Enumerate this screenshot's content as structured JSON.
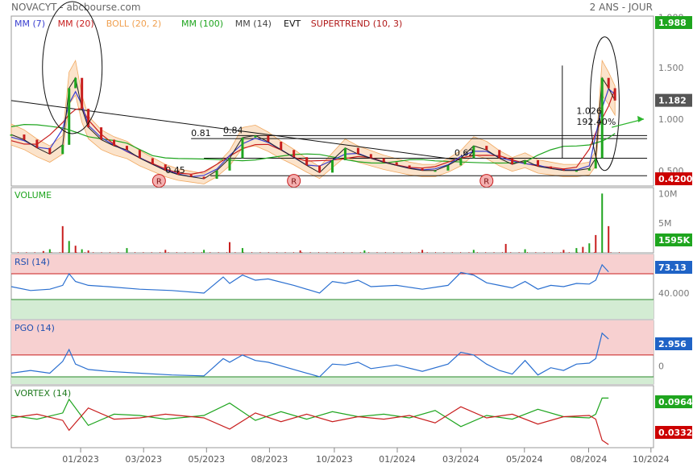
{
  "header": {
    "source": "NOVACYT - abcbourse.com",
    "period": "2 ANS - JOUR"
  },
  "colors": {
    "mm7": "#3a3fd0",
    "mm20": "#c81e1e",
    "boll": "#f0a050",
    "mm100": "#1fa51f",
    "mm14": "#444444",
    "evt": "#111111",
    "supertrend": "#b01818",
    "rsi_line": "#2a6fd0",
    "band_high": "#f7d0d0",
    "band_low": "#d3ecd3",
    "badge_green": "#1ea51e",
    "badge_red": "#cc0000",
    "badge_grey": "#555555",
    "badge_blue": "#1f63c6"
  },
  "chart_data": [
    {
      "panel": "price",
      "type": "line",
      "legend": [
        {
          "label": "MM (7)",
          "color": "#3a3fd0"
        },
        {
          "label": "MM (20)",
          "color": "#c81e1e"
        },
        {
          "label": "BOLL (20, 2)",
          "color": "#f0a050"
        },
        {
          "label": "MM (100)",
          "color": "#1fa51f"
        },
        {
          "label": "MM (14)",
          "color": "#444444"
        },
        {
          "label": "EVT",
          "color": "#111111"
        },
        {
          "label": "SUPERTREND (10, 3)",
          "color": "#b01818"
        }
      ],
      "x_ticks": [
        "01/2023",
        "03/2023",
        "05/2023",
        "08/2023",
        "10/2023",
        "01/2024",
        "03/2024",
        "05/2024",
        "08/2024",
        "10/2024"
      ],
      "y_ticks": [
        "1.988",
        "1.500",
        "1.000",
        "0.500"
      ],
      "ylim": [
        0.35,
        2.0
      ],
      "series": [
        {
          "name": "price",
          "x": [
            0,
            2,
            4,
            6,
            8,
            9,
            10,
            11,
            12,
            14,
            16,
            18,
            20,
            22,
            24,
            26,
            28,
            30,
            32,
            34,
            36,
            38,
            40,
            42,
            44,
            46,
            48,
            50,
            52,
            54,
            56,
            58,
            60,
            62,
            64,
            66,
            68,
            70,
            72,
            74,
            76,
            78,
            80,
            82,
            84,
            86,
            88,
            90,
            91,
            92,
            93,
            94
          ],
          "values": [
            0.85,
            0.8,
            0.72,
            0.66,
            0.75,
            1.3,
            1.4,
            1.1,
            0.92,
            0.8,
            0.74,
            0.7,
            0.62,
            0.56,
            0.5,
            0.46,
            0.44,
            0.42,
            0.5,
            0.62,
            0.82,
            0.84,
            0.78,
            0.7,
            0.63,
            0.55,
            0.48,
            0.6,
            0.72,
            0.66,
            0.62,
            0.58,
            0.55,
            0.52,
            0.5,
            0.5,
            0.55,
            0.62,
            0.74,
            0.7,
            0.62,
            0.56,
            0.6,
            0.54,
            0.52,
            0.5,
            0.5,
            0.52,
            0.62,
            1.4,
            1.3,
            1.18
          ]
        }
      ],
      "annotations": [
        {
          "text": "0.81",
          "x": 28,
          "y": 0.81
        },
        {
          "text": "0.84",
          "x": 33,
          "y": 0.84
        },
        {
          "text": "0.45",
          "x": 24,
          "y": 0.45
        },
        {
          "text": "0.62",
          "x": 69,
          "y": 0.62
        },
        {
          "text": "1.026",
          "x": 88,
          "y": 1.026
        },
        {
          "text": "192.40%",
          "x": 88,
          "y": 0.92
        },
        {
          "text": "R",
          "x": 23,
          "y": 0.4
        },
        {
          "text": "R",
          "x": 44,
          "y": 0.4
        },
        {
          "text": "R",
          "x": 74,
          "y": 0.4
        }
      ],
      "badges": [
        {
          "text": "1.988",
          "kind": "green",
          "y": 1.988
        },
        {
          "text": "1.182",
          "kind": "grey",
          "y": 1.182
        },
        {
          "text": "0.4200",
          "kind": "red",
          "y": 0.42
        }
      ]
    },
    {
      "panel": "volume",
      "type": "bar",
      "title": "VOLUME",
      "y_ticks": [
        "10M",
        "5M"
      ],
      "ylim": [
        0,
        11
      ],
      "x": [
        5,
        6,
        8,
        9,
        10,
        11,
        12,
        18,
        24,
        30,
        34,
        36,
        45,
        55,
        64,
        72,
        77,
        80,
        86,
        88,
        89,
        90,
        91,
        92,
        93
      ],
      "values": [
        0.3,
        0.6,
        4.5,
        2.0,
        1.2,
        0.6,
        0.4,
        0.8,
        0.5,
        0.5,
        1.8,
        0.8,
        0.4,
        0.4,
        0.5,
        0.5,
        1.5,
        0.6,
        0.5,
        0.8,
        1.0,
        1.6,
        3.0,
        10.0,
        4.5
      ],
      "badge": {
        "text": "1595K",
        "kind": "green"
      }
    },
    {
      "panel": "rsi",
      "type": "line",
      "title": "RSI (14)",
      "y_ticks": [
        "40.000"
      ],
      "ylim": [
        0,
        100
      ],
      "bands": {
        "upper": 70,
        "lower": 30
      },
      "x": [
        0,
        3,
        6,
        8,
        9,
        10,
        12,
        15,
        20,
        25,
        30,
        33,
        34,
        36,
        38,
        40,
        44,
        48,
        50,
        52,
        54,
        56,
        60,
        64,
        68,
        70,
        72,
        74,
        76,
        78,
        80,
        82,
        84,
        86,
        88,
        90,
        91,
        92,
        93
      ],
      "values": [
        50,
        44,
        46,
        52,
        70,
        58,
        52,
        50,
        46,
        44,
        40,
        65,
        55,
        68,
        60,
        62,
        52,
        40,
        58,
        55,
        60,
        50,
        52,
        46,
        52,
        72,
        68,
        56,
        52,
        48,
        58,
        46,
        52,
        50,
        55,
        54,
        60,
        84,
        73
      ],
      "badge": {
        "text": "73.13",
        "kind": "blue"
      }
    },
    {
      "panel": "pgo",
      "type": "line",
      "title": "PGO (14)",
      "y_ticks": [
        "0"
      ],
      "ylim": [
        -2,
        5
      ],
      "x": [
        0,
        3,
        6,
        8,
        9,
        10,
        12,
        15,
        20,
        25,
        30,
        33,
        34,
        36,
        38,
        40,
        44,
        48,
        50,
        52,
        54,
        56,
        60,
        64,
        68,
        70,
        72,
        74,
        76,
        78,
        80,
        82,
        84,
        86,
        88,
        90,
        91,
        92,
        93
      ],
      "values": [
        -0.8,
        -0.5,
        -0.8,
        0.5,
        1.8,
        0.2,
        -0.4,
        -0.6,
        -0.8,
        -1.0,
        -1.1,
        0.8,
        0.4,
        1.2,
        0.6,
        0.4,
        -0.4,
        -1.2,
        0.2,
        0.1,
        0.4,
        -0.3,
        0.1,
        -0.6,
        0.2,
        1.5,
        1.2,
        0.2,
        -0.5,
        -0.9,
        0.6,
        -1.0,
        -0.2,
        -0.5,
        0.2,
        0.3,
        0.8,
        3.6,
        2.956
      ],
      "badge": {
        "text": "2.956",
        "kind": "blue"
      }
    },
    {
      "panel": "vortex",
      "type": "line",
      "title": "VORTEX (14)",
      "ylim": [
        0.5,
        1.5
      ],
      "x": [
        0,
        4,
        8,
        9,
        12,
        16,
        20,
        24,
        30,
        34,
        38,
        42,
        46,
        50,
        54,
        58,
        62,
        66,
        70,
        74,
        78,
        82,
        86,
        90,
        91,
        92,
        93
      ],
      "series": [
        {
          "name": "VI+",
          "values": [
            1.02,
            0.96,
            1.06,
            1.28,
            0.86,
            1.04,
            1.02,
            0.96,
            1.02,
            1.22,
            0.94,
            1.08,
            0.96,
            1.08,
            1.0,
            1.04,
            0.98,
            1.1,
            0.84,
            1.02,
            0.96,
            1.12,
            1.0,
            0.98,
            1.04,
            1.3,
            1.3
          ]
        },
        {
          "name": "VI-",
          "values": [
            0.98,
            1.04,
            0.94,
            0.78,
            1.14,
            0.96,
            0.98,
            1.04,
            0.98,
            0.8,
            1.06,
            0.92,
            1.04,
            0.92,
            1.0,
            0.96,
            1.02,
            0.9,
            1.16,
            0.98,
            1.04,
            0.88,
            1.0,
            1.02,
            0.96,
            0.62,
            0.55
          ]
        }
      ],
      "badges": [
        {
          "text": "0.0964",
          "kind": "green"
        },
        {
          "text": "0.0332",
          "kind": "red"
        }
      ]
    }
  ]
}
